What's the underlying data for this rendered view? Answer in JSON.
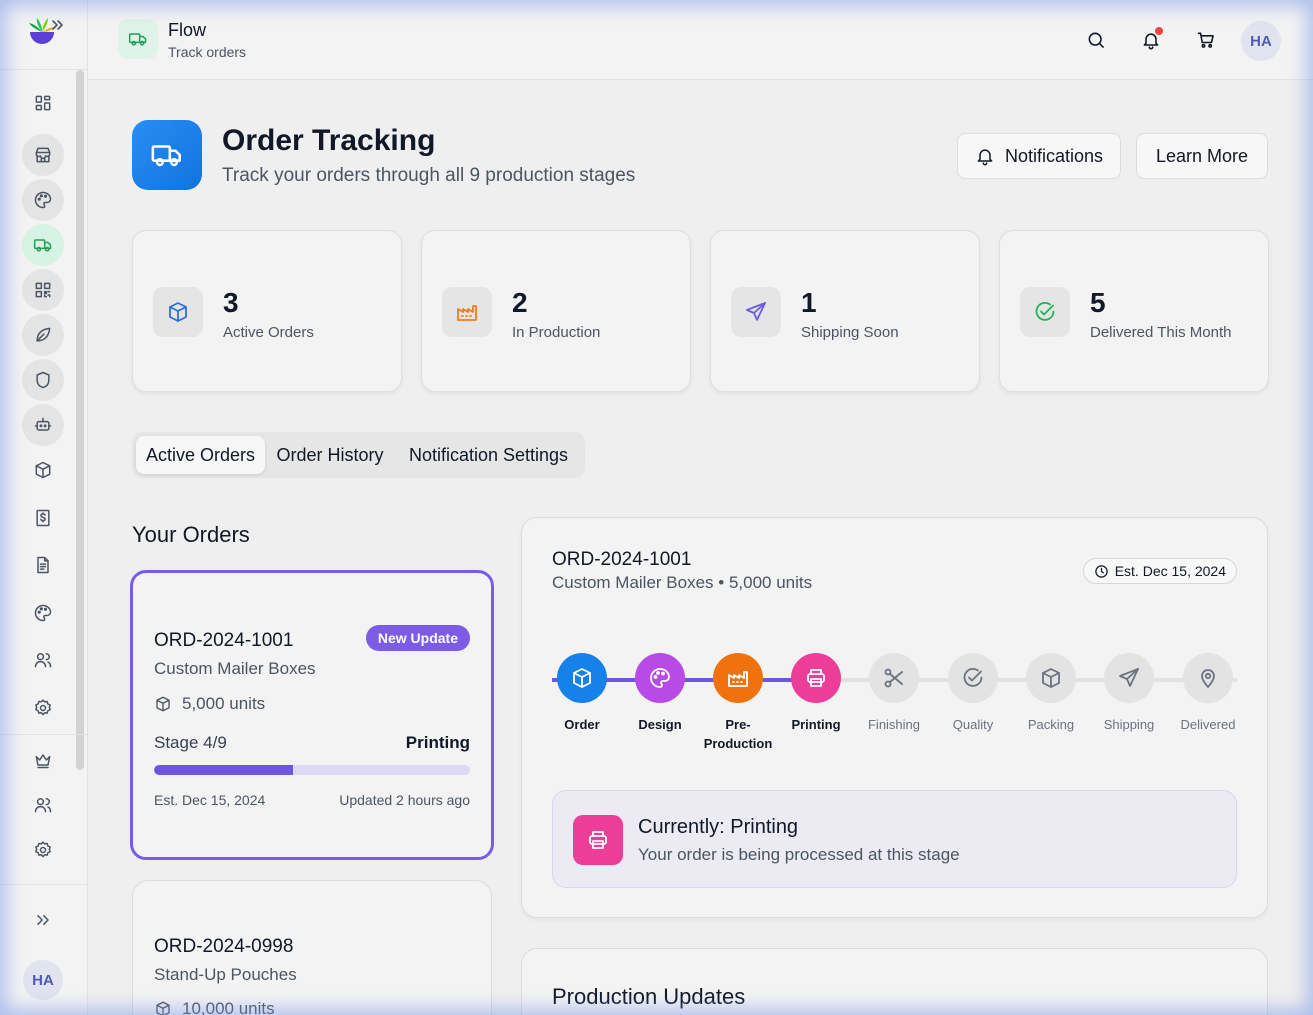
{
  "app": {
    "title": "Flow",
    "subtitle": "Track orders",
    "avatar_initials": "HA"
  },
  "colors": {
    "accent": "#7c5ce6",
    "brand_green": "#22a05b",
    "primary_blue": "#1581e9",
    "printing_pink": "#ec3d98",
    "notification_dot": "#ef4444"
  },
  "sidebar": {
    "items": [
      {
        "name": "dashboard",
        "icon": "grid-icon",
        "active": false
      },
      {
        "name": "store",
        "icon": "store-icon",
        "active": false
      },
      {
        "name": "design",
        "icon": "palette-icon",
        "active": false
      },
      {
        "name": "track-orders",
        "icon": "truck-icon",
        "active": true
      },
      {
        "name": "qr-codes",
        "icon": "qr-code-icon",
        "active": false
      },
      {
        "name": "sustainability",
        "icon": "leaf-icon",
        "active": false
      },
      {
        "name": "security",
        "icon": "shield-icon",
        "active": false
      },
      {
        "name": "automation",
        "icon": "robot-icon",
        "active": false
      },
      {
        "name": "products",
        "icon": "box-icon",
        "active": false
      },
      {
        "name": "billing",
        "icon": "dollar-icon",
        "active": false
      },
      {
        "name": "documents",
        "icon": "document-icon",
        "active": false
      },
      {
        "name": "brand-kit",
        "icon": "palette-icon",
        "active": false
      },
      {
        "name": "team",
        "icon": "users-icon",
        "active": false
      },
      {
        "name": "settings",
        "icon": "gear-icon",
        "active": false
      },
      {
        "name": "premium",
        "icon": "crown-icon",
        "active": false
      },
      {
        "name": "admin-users",
        "icon": "users-icon",
        "active": false
      },
      {
        "name": "admin-settings",
        "icon": "gear-icon",
        "active": false
      }
    ],
    "expand_icon": "chevrons-right-icon",
    "avatar_initials": "HA"
  },
  "page": {
    "title": "Order Tracking",
    "subtitle": "Track your orders through all 9 production stages",
    "notifications_label": "Notifications",
    "learn_more_label": "Learn More"
  },
  "stats": [
    {
      "value": "3",
      "label": "Active Orders",
      "icon": "box-icon",
      "color": "#2f6fe0"
    },
    {
      "value": "2",
      "label": "In Production",
      "icon": "factory-icon",
      "color": "#f07d1b"
    },
    {
      "value": "1",
      "label": "Shipping Soon",
      "icon": "send-icon",
      "color": "#6b5ce0"
    },
    {
      "value": "5",
      "label": "Delivered This Month",
      "icon": "check-circle-icon",
      "color": "#20b35a"
    }
  ],
  "tabs": [
    {
      "label": "Active Orders",
      "active": true
    },
    {
      "label": "Order History",
      "active": false
    },
    {
      "label": "Notification Settings",
      "active": false
    }
  ],
  "orders_section": {
    "title": "Your Orders",
    "orders": [
      {
        "id": "ORD-2024-1001",
        "name": "Custom Mailer Boxes",
        "units": "5,000 units",
        "badge": "New Update",
        "stage_text": "Stage 4/9",
        "stage_name": "Printing",
        "progress": 0.44,
        "est": "Est. Dec 15, 2024",
        "updated": "Updated 2 hours ago"
      },
      {
        "id": "ORD-2024-0998",
        "name": "Stand-Up Pouches",
        "units": "10,000 units"
      }
    ]
  },
  "detail": {
    "id": "ORD-2024-1001",
    "subtitle": "Custom Mailer Boxes • 5,000 units",
    "est": "Est. Dec 15, 2024",
    "steps": [
      {
        "label": "Order",
        "icon": "box-icon",
        "done": true,
        "color": "#1581e9"
      },
      {
        "label": "Design",
        "icon": "palette-icon",
        "done": true,
        "color": "#b84be5"
      },
      {
        "label": "Pre-Production",
        "line1": "Pre-",
        "line2": "Production",
        "icon": "factory-icon",
        "done": true,
        "color": "#f0720f"
      },
      {
        "label": "Printing",
        "icon": "printer-icon",
        "done": true,
        "color": "#ec3d98"
      },
      {
        "label": "Finishing",
        "icon": "scissors-icon",
        "done": false
      },
      {
        "label": "Quality",
        "icon": "check-circle-icon",
        "done": false
      },
      {
        "label": "Packing",
        "icon": "box-icon",
        "done": false
      },
      {
        "label": "Shipping",
        "icon": "send-icon",
        "done": false
      },
      {
        "label": "Delivered",
        "icon": "map-pin-icon",
        "done": false
      }
    ],
    "current_title": "Currently: Printing",
    "current_sub": "Your order is being processed at this stage"
  },
  "updates": {
    "title": "Production Updates"
  }
}
